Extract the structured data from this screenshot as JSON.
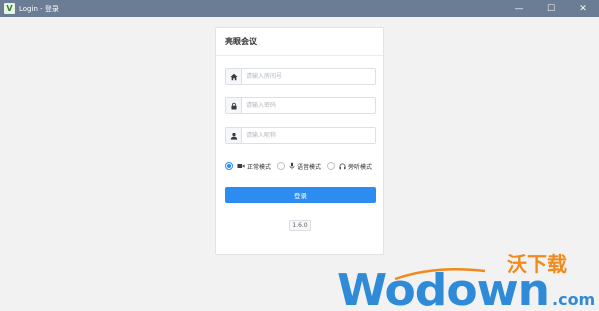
{
  "window": {
    "app_icon_letter": "V",
    "title": "Login - 登录",
    "controls": {
      "minimize": "—",
      "maximize": "☐",
      "close": "✕"
    }
  },
  "card": {
    "title": "亮眼会议",
    "fields": [
      {
        "name": "room",
        "icon": "home-icon",
        "value": "",
        "placeholder": "请输入房间号"
      },
      {
        "name": "password",
        "icon": "lock-icon",
        "value": "",
        "placeholder": "请输入密码"
      },
      {
        "name": "nickname",
        "icon": "user-icon",
        "value": "",
        "placeholder": "请输入昵称"
      }
    ],
    "modes": [
      {
        "label": "正常模式",
        "icon": "video-camera-icon",
        "checked": true
      },
      {
        "label": "语音模式",
        "icon": "microphone-icon",
        "checked": false
      },
      {
        "label": "旁听模式",
        "icon": "headphones-icon",
        "checked": false
      }
    ],
    "login_label": "登录",
    "version": "1.6.0"
  },
  "watermark": {
    "main": "Wodown",
    "cn": "沃下载",
    "suffix": ".com"
  },
  "colors": {
    "titlebar": "#6a7d95",
    "accent": "#2d8cf0",
    "watermark_blue": "#2f8bd8",
    "watermark_orange": "#f08a1c"
  }
}
